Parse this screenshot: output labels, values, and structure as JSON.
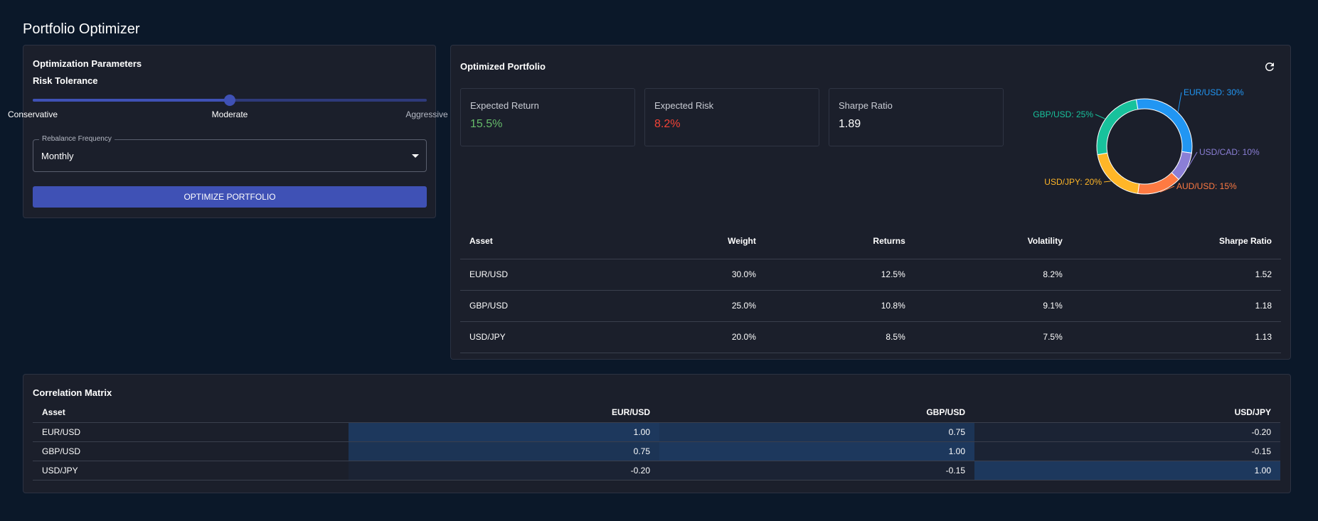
{
  "page": {
    "title": "Portfolio Optimizer"
  },
  "colors": {
    "accent": "#3f51b5",
    "positive": "#66bb6a",
    "negative": "#f44336",
    "eurusd": "#2196f3",
    "usdcad": "#8b7fd6",
    "audusd": "#ff7a42",
    "usdjpy": "#ffb627",
    "gbpusd": "#18c29c"
  },
  "params": {
    "title": "Optimization Parameters",
    "risk_label": "Risk Tolerance",
    "risk_value": 0.5,
    "marks": [
      "Conservative",
      "Moderate",
      "Aggressive"
    ],
    "frequency_label": "Rebalance Frequency",
    "frequency_value": "Monthly",
    "button_label": "OPTIMIZE PORTFOLIO"
  },
  "portfolio": {
    "title": "Optimized Portfolio",
    "refresh_icon": "refresh-icon",
    "metrics": [
      {
        "label": "Expected Return",
        "value": "15.5%",
        "tone": "positive"
      },
      {
        "label": "Expected Risk",
        "value": "8.2%",
        "tone": "negative"
      },
      {
        "label": "Sharpe Ratio",
        "value": "1.89",
        "tone": "neutral"
      }
    ],
    "allocation": {
      "slices": [
        {
          "label": "EUR/USD: 30%",
          "value": 30,
          "color": "#2196f3"
        },
        {
          "label": "USD/CAD: 10%",
          "value": 10,
          "color": "#8b7fd6"
        },
        {
          "label": "AUD/USD: 15%",
          "value": 15,
          "color": "#ff7a42"
        },
        {
          "label": "USD/JPY: 20%",
          "value": 20,
          "color": "#ffb627"
        },
        {
          "label": "GBP/USD: 25%",
          "value": 25,
          "color": "#18c29c"
        }
      ]
    },
    "table": {
      "headers": [
        "Asset",
        "Weight",
        "Returns",
        "Volatility",
        "Sharpe Ratio"
      ],
      "rows": [
        [
          "EUR/USD",
          "30.0%",
          "12.5%",
          "8.2%",
          "1.52"
        ],
        [
          "GBP/USD",
          "25.0%",
          "10.8%",
          "9.1%",
          "1.18"
        ],
        [
          "USD/JPY",
          "20.0%",
          "8.5%",
          "7.5%",
          "1.13"
        ]
      ]
    }
  },
  "correlation": {
    "title": "Correlation Matrix",
    "headers": [
      "Asset",
      "EUR/USD",
      "GBP/USD",
      "USD/JPY"
    ],
    "rows": [
      {
        "asset": "EUR/USD",
        "cells": [
          {
            "text": "1.00",
            "value": 1.0
          },
          {
            "text": "0.75",
            "value": 0.75
          },
          {
            "text": "-0.20",
            "value": -0.2
          }
        ]
      },
      {
        "asset": "GBP/USD",
        "cells": [
          {
            "text": "0.75",
            "value": 0.75
          },
          {
            "text": "1.00",
            "value": 1.0
          },
          {
            "text": "-0.15",
            "value": -0.15
          }
        ]
      },
      {
        "asset": "USD/JPY",
        "cells": [
          {
            "text": "-0.20",
            "value": -0.2
          },
          {
            "text": "-0.15",
            "value": -0.15
          },
          {
            "text": "1.00",
            "value": 1.0
          }
        ]
      }
    ]
  }
}
